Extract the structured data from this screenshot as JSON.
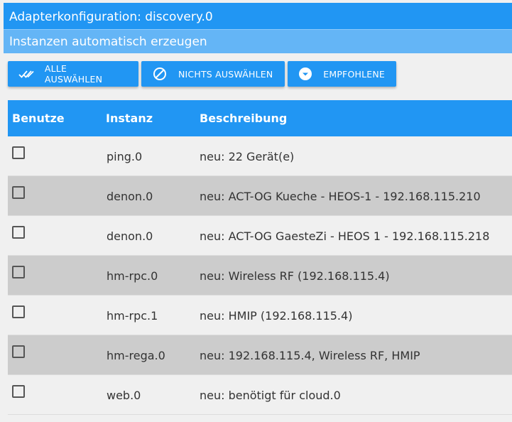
{
  "window": {
    "title": "Adapterkonfiguration: discovery.0",
    "subtitle": "Instanzen automatisch erzeugen"
  },
  "toolbar": {
    "select_all_label": "ALLE AUSWÄHLEN",
    "select_none_label": "NICHTS AUSWÄHLEN",
    "recommended_label": "EMPFOHLENE"
  },
  "table": {
    "headers": {
      "use": "Benutze",
      "instance": "Instanz",
      "description": "Beschreibung"
    },
    "rows": [
      {
        "checked": false,
        "instance": "ping.0",
        "description": "neu: 22 Gerät(e)"
      },
      {
        "checked": false,
        "instance": "denon.0",
        "description": "neu: ACT-OG Kueche - HEOS-1 - 192.168.115.210"
      },
      {
        "checked": false,
        "instance": "denon.0",
        "description": "neu: ACT-OG GaesteZi - HEOS 1 - 192.168.115.218"
      },
      {
        "checked": false,
        "instance": "hm-rpc.0",
        "description": "neu: Wireless RF (192.168.115.4)"
      },
      {
        "checked": false,
        "instance": "hm-rpc.1",
        "description": "neu: HMIP (192.168.115.4)"
      },
      {
        "checked": false,
        "instance": "hm-rega.0",
        "description": "neu: 192.168.115.4, Wireless RF, HMIP"
      },
      {
        "checked": false,
        "instance": "web.0",
        "description": "neu: benötigt für cloud.0"
      }
    ]
  },
  "colors": {
    "primary": "#2196f3",
    "primary_light": "#64b5f6",
    "row_alt": "#cccccc"
  }
}
